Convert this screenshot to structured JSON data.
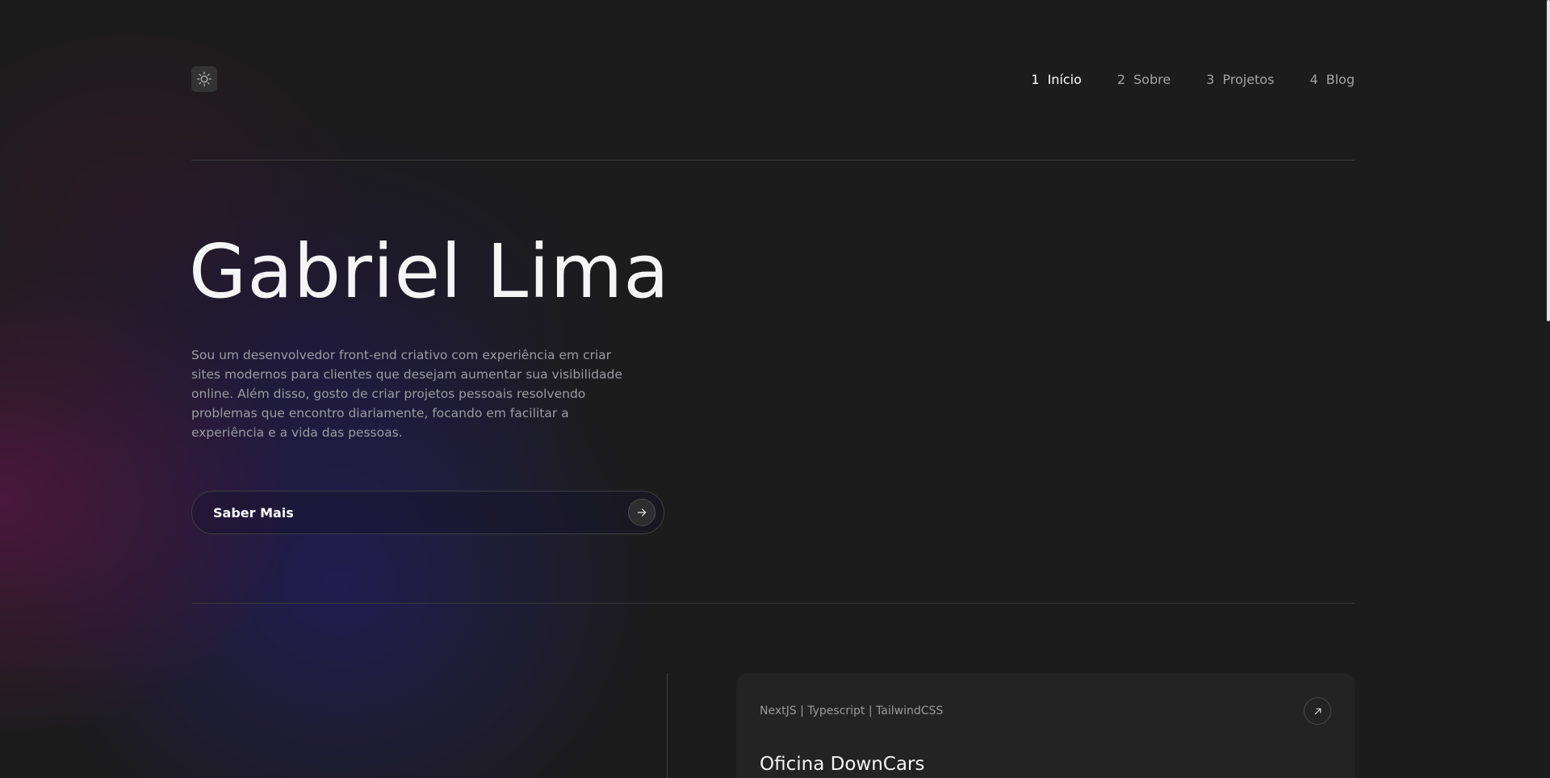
{
  "header": {
    "theme_toggle_icon": "sun-icon",
    "nav": [
      {
        "number": "1",
        "label": "Início",
        "active": true
      },
      {
        "number": "2",
        "label": "Sobre",
        "active": false
      },
      {
        "number": "3",
        "label": "Projetos",
        "active": false
      },
      {
        "number": "4",
        "label": "Blog",
        "active": false
      }
    ]
  },
  "hero": {
    "title": "Gabriel Lima",
    "description": "Sou um desenvolvedor front-end criativo com experiência em criar sites modernos para clientes que desejam aumentar sua visibilidade online. Além disso, gosto de criar projetos pessoais resolvendo problemas que encontro diariamente, focando em facilitar a experiência e a vida das pessoas.",
    "cta_label": "Saber Mais",
    "cta_icon": "arrow-right-icon"
  },
  "project": {
    "tags": "NextJS | Typescript | TailwindCSS",
    "title": "Oficina DownCars",
    "link_icon": "arrow-up-right-icon"
  },
  "colors": {
    "background": "#1c1c1c",
    "text_primary": "#f5f5f5",
    "text_muted": "#9b9ba3",
    "glow_magenta": "#5a1648",
    "glow_indigo": "#231c5a",
    "card_background": "#232323"
  }
}
